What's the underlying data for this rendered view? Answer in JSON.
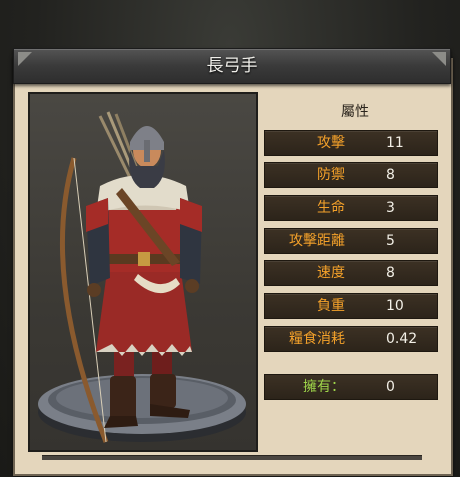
{
  "window": {
    "title": "長弓手"
  },
  "attributes": {
    "heading": "屬性",
    "stats": [
      {
        "label": "攻擊",
        "value": "11"
      },
      {
        "label": "防禦",
        "value": "8"
      },
      {
        "label": "生命",
        "value": "3"
      },
      {
        "label": "攻擊距離",
        "value": "5"
      },
      {
        "label": "速度",
        "value": "8"
      },
      {
        "label": "負重",
        "value": "10"
      },
      {
        "label": "糧食消耗",
        "value": "0.42"
      }
    ],
    "owned": {
      "label": "擁有：",
      "value": "0"
    }
  },
  "colors": {
    "stat_label": "#f4a12a",
    "owned_label": "#9fd64a",
    "panel_bg": "#e4d6bc",
    "row_bg": "#2c241a"
  },
  "unit": {
    "name": "長弓手",
    "portrait": "longbowman-figure"
  }
}
